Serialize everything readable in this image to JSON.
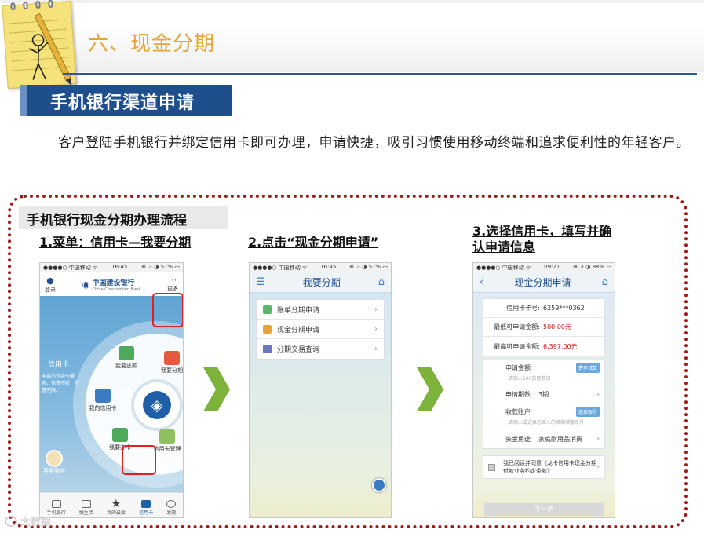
{
  "header": {
    "title": "六、现金分期"
  },
  "section": {
    "label": "手机银行渠道申请"
  },
  "intro": {
    "text": "客户登陆手机银行并绑定信用卡即可办理，申请快捷，吸引习惯使用移动终端和追求便利性的年轻客户。"
  },
  "flow": {
    "title": "手机银行现金分期办理流程",
    "steps": [
      {
        "label": "1.菜单：信用卡—我要分期"
      },
      {
        "label": "2.点击“现金分期申请”"
      },
      {
        "label": "3.选择信用卡，填写并确认申请信息"
      }
    ]
  },
  "phone1": {
    "status_left": "●●●●○ 中国移动 ᯤ",
    "time": "16:45",
    "status_right": "⊕ ⊿ ◑ 57% ▭",
    "login": "登录",
    "bank_name": "中国建设银行",
    "bank_en": "China Construction Bank",
    "more": "更多",
    "card_title": "信用卡",
    "card_desc": "丰富的信用卡服务，惊喜不断，特惠无限。",
    "service": "客服服务",
    "wheel": {
      "repay": "我要还款",
      "installment": "我要分期",
      "my_card": "我的信用卡",
      "apply": "我要办卡",
      "manage": "信用卡管理"
    },
    "tabs": [
      "手机银行",
      "悦生活",
      "我的最爱",
      "信用卡",
      "发现"
    ]
  },
  "phone2": {
    "status_left": "●●●●○ 中国移动 ᯤ",
    "time": "16:45",
    "status_right": "⊕ ⊿ ◑ 57% ▭",
    "title": "我要分期",
    "menu": [
      {
        "label": "账单分期申请",
        "color": "#5bb56a"
      },
      {
        "label": "现金分期申请",
        "color": "#e8a23a"
      },
      {
        "label": "分期交易查询",
        "color": "#6a78c4"
      }
    ]
  },
  "phone3": {
    "status_left": "●●●●○ 中国移动 ᯤ",
    "time": "09:21",
    "status_right": "⊕ ⊿ ◑ 88% ▭",
    "title": "现金分期申请",
    "card_label": "信用卡卡号:",
    "card_value": "6259***0362",
    "min_label": "最低可申请金额:",
    "min_value": "500.00元",
    "max_label": "最高可申请金额:",
    "max_value": "6,397.00元",
    "amount_label": "申请金额",
    "amount_btn": "费率试算",
    "amount_hint": "请输入100的整数倍",
    "periods_label": "申请期数",
    "periods_value": "3期",
    "account_label": "收款账户",
    "account_btn": "选择账号",
    "account_hint": "请输入或选择您本人的活期储蓄账号",
    "usage_label": "资金用途",
    "usage_value": "家庭耐用品消费",
    "agree_text": "我已阅读并同意《龙卡信用卡现金分期付款业务约定条款》",
    "next": "下一步"
  },
  "watermark": {
    "text": "大数据"
  }
}
